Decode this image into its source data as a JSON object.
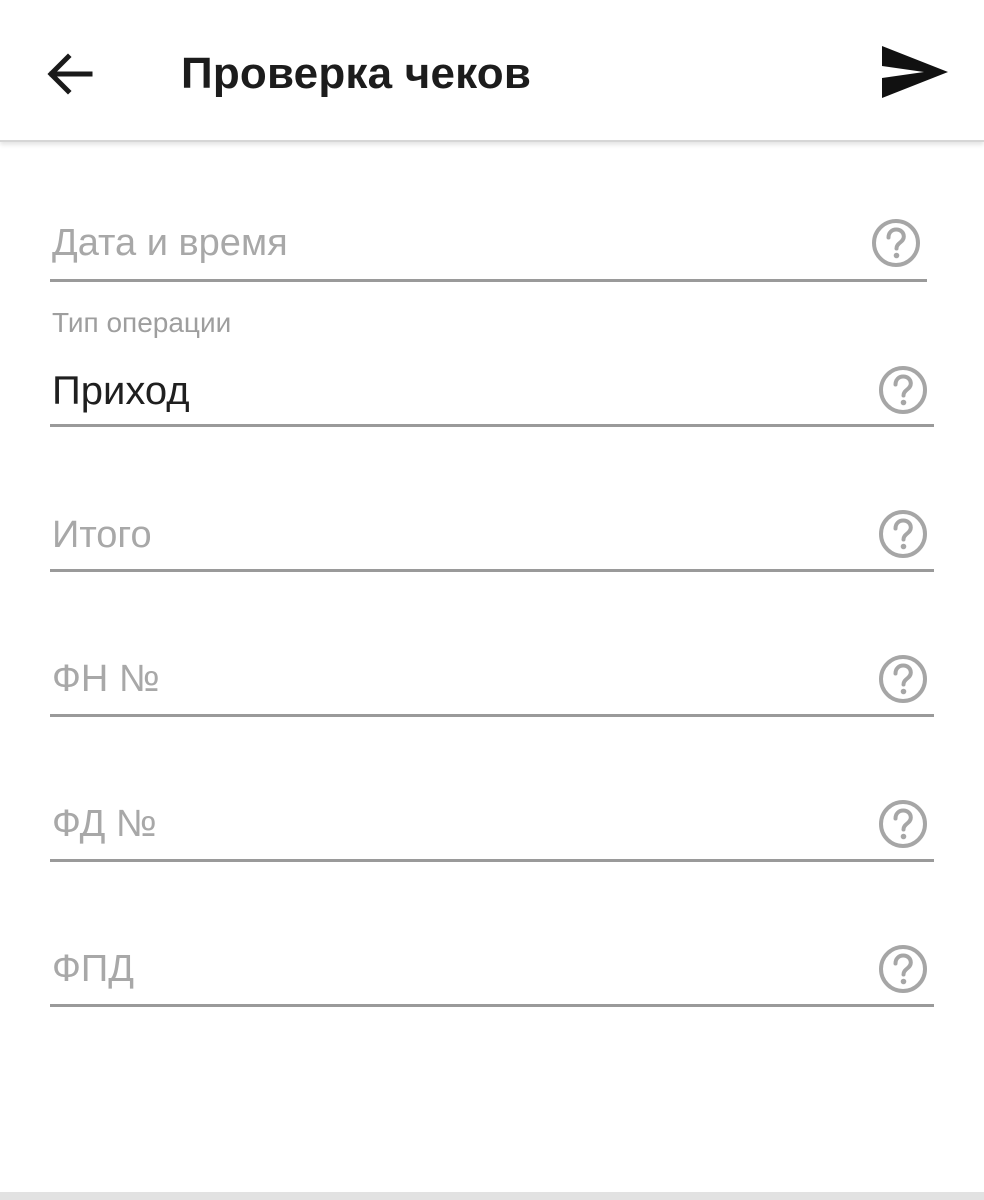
{
  "app_bar": {
    "title": "Проверка чеков",
    "back_icon": "arrow-left-icon",
    "send_icon": "send-icon"
  },
  "form": {
    "fields": [
      {
        "id": "datetime",
        "placeholder": "Дата и время",
        "value": "",
        "help_icon": "help-circle-icon"
      },
      {
        "id": "operation_type",
        "label": "Тип операции",
        "value": "Приход",
        "help_icon": "help-circle-icon"
      },
      {
        "id": "total",
        "placeholder": "Итого",
        "value": "",
        "help_icon": "help-circle-icon"
      },
      {
        "id": "fn",
        "placeholder": "ФН №",
        "value": "",
        "help_icon": "help-circle-icon"
      },
      {
        "id": "fd",
        "placeholder": "ФД №",
        "value": "",
        "help_icon": "help-circle-icon"
      },
      {
        "id": "fpd",
        "placeholder": "ФПД",
        "value": "",
        "help_icon": "help-circle-icon"
      }
    ]
  },
  "colors": {
    "app_bar_background": "#ffffff",
    "title_text": "#1c1c1c",
    "placeholder_text": "#a8a8a8",
    "value_text": "#1f1f1f",
    "underline": "#9a9a9a",
    "help_icon": "#a6a6a6"
  }
}
